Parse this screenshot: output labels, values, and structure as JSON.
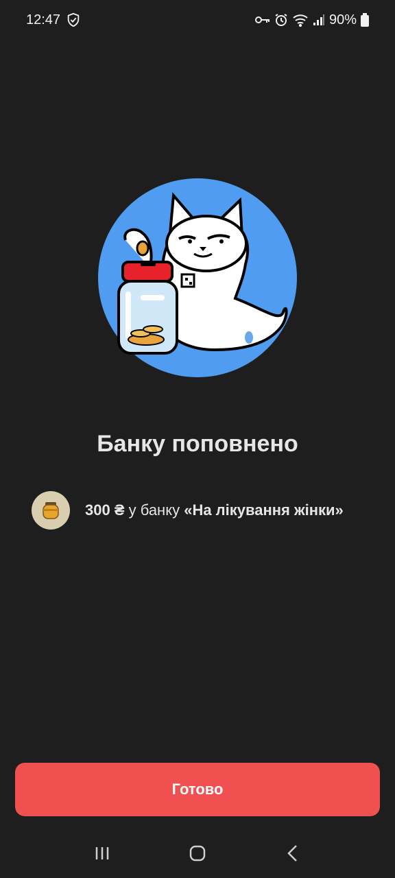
{
  "status_bar": {
    "time": "12:47",
    "battery": "90%",
    "icons": [
      "shield-check-icon",
      "key-icon",
      "alarm-icon",
      "wifi-icon",
      "signal-icon",
      "battery-icon"
    ]
  },
  "illustration": {
    "name": "cat-with-piggy-jar",
    "circle_color": "#4f9cf0",
    "lid_color": "#e8222b"
  },
  "title": "Банку поповнено",
  "info": {
    "icon": "honey-jar-icon",
    "amount": "300 ₴",
    "middle": " у банку ",
    "jar_name": "«На лікування жінки»"
  },
  "done_button": {
    "label": "Готово",
    "color": "#f05050"
  },
  "nav": {
    "icons": [
      "recent-apps-icon",
      "home-icon",
      "back-icon"
    ]
  }
}
